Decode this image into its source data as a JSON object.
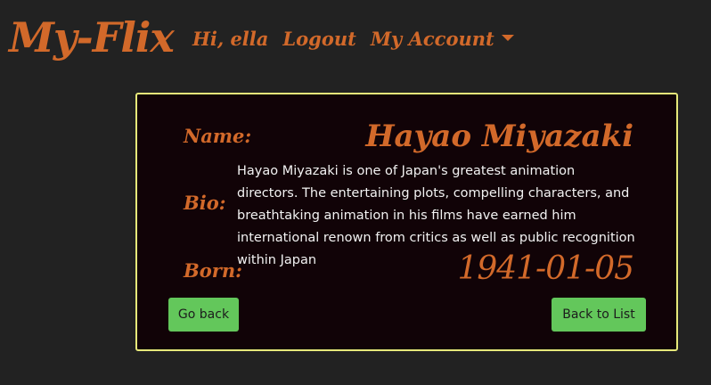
{
  "navbar": {
    "brand": "My-Flix",
    "greeting": "Hi, ella",
    "logout": "Logout",
    "account": "My Account"
  },
  "director": {
    "name_label": "Name:",
    "name": "Hayao Miyazaki",
    "bio_label": "Bio:",
    "bio": "Hayao Miyazaki is one of Japan's greatest animation directors. The entertaining plots, compelling characters, and breathtaking animation in his films have earned him international renown from critics as well as public recognition within Japan",
    "born_label": "Born:",
    "birth": "1941-01-05"
  },
  "buttons": {
    "go_back": "Go back",
    "back_to_list": "Back to List"
  },
  "colors": {
    "accent": "#d2692a",
    "background": "#222222",
    "card": "#110307",
    "card_border": "#e6e87a",
    "button": "#63c75b"
  },
  "icons": {
    "account_dropdown": "caret-down-icon"
  }
}
